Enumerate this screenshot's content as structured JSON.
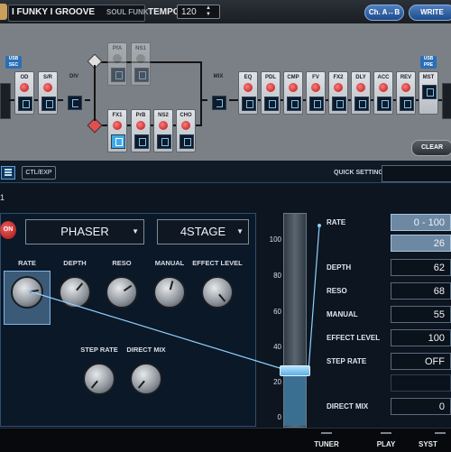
{
  "header": {
    "patch_name": "I FUNKY I GROOVE",
    "patch_style": "SOUL FUNK",
    "tempo_label": "TEMPO",
    "tempo_value": "120",
    "channel_button": "Ch. A↔B",
    "write_button": "WRITE"
  },
  "chain": {
    "usb_sec": "USB SEC",
    "usb_pre": "USB PRE",
    "top_blocks": [
      "OD",
      "S/R",
      "DIV"
    ],
    "branch_a": [
      "PfA",
      "NS1"
    ],
    "branch_b": [
      "FX1",
      "PrB",
      "NS2",
      "CHO"
    ],
    "mix": "MIX",
    "post_blocks": [
      "EQ",
      "PDL",
      "CMP",
      "FV",
      "FX2",
      "DLY",
      "ACC",
      "REV",
      "MST"
    ],
    "clear_button": "CLEAR"
  },
  "edit_toolbar": {
    "ctl_exp": "CTL/EXP",
    "quick_setting": "QUICK SETTING",
    "block_number": "1"
  },
  "effect": {
    "on_label": "ON",
    "type": "PHASER",
    "mode": "4STAGE",
    "knobs_row1": [
      "RATE",
      "DEPTH",
      "RESO",
      "MANUAL",
      "EFFECT LEVEL"
    ],
    "knobs_row2": [
      "STEP RATE",
      "DIRECT MIX"
    ]
  },
  "slider": {
    "scale": [
      "100",
      "80",
      "60",
      "40",
      "20",
      "0"
    ],
    "value": 26
  },
  "params": [
    {
      "label": "RATE",
      "value": "0 - 100",
      "selected": true
    },
    {
      "label": "",
      "value": "26",
      "selected": true
    },
    {
      "label": "DEPTH",
      "value": "62",
      "selected": false
    },
    {
      "label": "RESO",
      "value": "68",
      "selected": false
    },
    {
      "label": "MANUAL",
      "value": "55",
      "selected": false
    },
    {
      "label": "EFFECT LEVEL",
      "value": "100",
      "selected": false
    },
    {
      "label": "STEP RATE",
      "value": "OFF",
      "selected": false
    },
    {
      "label": "",
      "value": "",
      "selected": false
    },
    {
      "label": "DIRECT MIX",
      "value": "0",
      "selected": false
    }
  ],
  "bottom_bar": {
    "tuner": "TUNER",
    "play": "PLAY",
    "system": "SYST"
  },
  "colors": {
    "accent": "#4e7fc0",
    "led_red": "#d42020",
    "panel_bg": "#0b1827",
    "selected_value": "#6c88a3"
  }
}
